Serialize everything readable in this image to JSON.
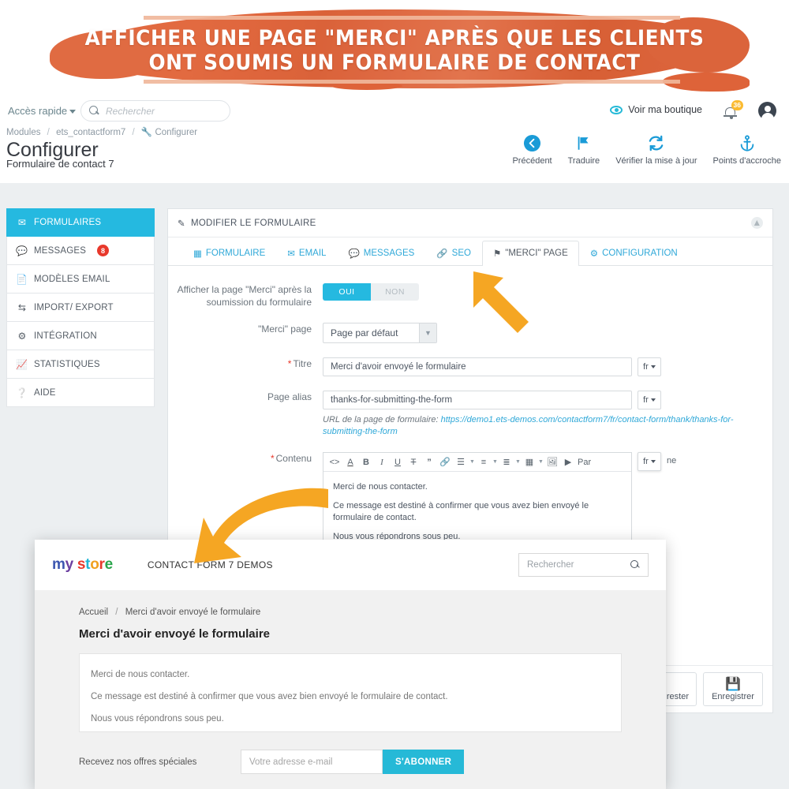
{
  "banner": {
    "line1": "AFFICHER UNE PAGE \"MERCI\" APRÈS QUE LES CLIENTS",
    "line2": "ONT SOUMIS UN FORMULAIRE DE CONTACT",
    "color": "#de6339"
  },
  "topbar": {
    "quick_access": "Accès rapide",
    "search_placeholder": "Rechercher",
    "view_shop": "Voir ma boutique",
    "notification_count": "36"
  },
  "breadcrumb": {
    "item1": "Modules",
    "item2": "ets_contactform7",
    "item3": "Configurer"
  },
  "page": {
    "title": "Configurer",
    "subtitle": "Formulaire de contact 7"
  },
  "header_actions": [
    {
      "label": "Précédent",
      "icon": "back-arrow-icon"
    },
    {
      "label": "Traduire",
      "icon": "flag-icon"
    },
    {
      "label": "Vérifier la mise à jour",
      "icon": "refresh-icon"
    },
    {
      "label": "Points d'accroche",
      "icon": "anchor-icon"
    }
  ],
  "sidebar": {
    "items": [
      {
        "label": "FORMULAIRES",
        "icon": "envelope-icon",
        "active": true,
        "badge": null
      },
      {
        "label": "MESSAGES",
        "icon": "chat-icon",
        "active": false,
        "badge": "8"
      },
      {
        "label": "MODÈLES EMAIL",
        "icon": "document-icon",
        "active": false,
        "badge": null
      },
      {
        "label": "IMPORT/ EXPORT",
        "icon": "exchange-icon",
        "active": false,
        "badge": null
      },
      {
        "label": "INTÉGRATION",
        "icon": "gears-icon",
        "active": false,
        "badge": null
      },
      {
        "label": "STATISTIQUES",
        "icon": "chart-icon",
        "active": false,
        "badge": null
      },
      {
        "label": "AIDE",
        "icon": "help-icon",
        "active": false,
        "badge": null
      }
    ]
  },
  "panel": {
    "header": "MODIFIER LE FORMULAIRE",
    "tabs": [
      {
        "label": "FORMULAIRE",
        "icon": "form-icon",
        "active": false
      },
      {
        "label": "EMAIL",
        "icon": "envelope-icon",
        "active": false
      },
      {
        "label": "MESSAGES",
        "icon": "chat-icon",
        "active": false
      },
      {
        "label": "SEO",
        "icon": "link-icon",
        "active": false
      },
      {
        "label": "\"MERCI\" PAGE",
        "icon": "flag-icon",
        "active": true
      },
      {
        "label": "CONFIGURATION",
        "icon": "gear-icon",
        "active": false
      }
    ],
    "form": {
      "show_thanks_label": "Afficher la page \"Merci\" après la soumission du formulaire",
      "toggle_on": "OUI",
      "toggle_off": "NON",
      "toggle_value": "OUI",
      "thanks_page_label": "\"Merci\" page",
      "thanks_page_value": "Page par défaut",
      "title_label": "Titre",
      "title_value": "Merci d'avoir envoyé le formulaire",
      "alias_label": "Page alias",
      "alias_value": "thanks-for-submitting-the-form",
      "lang": "fr",
      "url_note_prefix": "URL de la page de formulaire:",
      "url_note_link": "https://demo1.ets-demos.com/contactform7/fr/contact-form/thank/thanks-for-submitting-the-form",
      "content_label": "Contenu",
      "content_p1": "Merci de nous contacter.",
      "content_p2": "Ce message est destiné à confirmer que vous avez bien envoyé le formulaire de contact.",
      "content_p3": "Nous vous répondrons sous peu.",
      "toolbar_paragraph": "Par",
      "toolbar_size": "ne"
    },
    "footer": {
      "save_stay": "Enregistrer et rester",
      "save": "Enregistrer"
    }
  },
  "storefront": {
    "logo_letters": [
      "m",
      "y",
      "s",
      "t",
      "o",
      "r",
      "e"
    ],
    "logo_text": "my store",
    "nav": "CONTACT FORM 7 DEMOS",
    "search_placeholder": "Rechercher",
    "breadcrumb_home": "Accueil",
    "breadcrumb_current": "Merci d'avoir envoyé le formulaire",
    "heading": "Merci d'avoir envoyé le formulaire",
    "body_p1": "Merci de nous contacter.",
    "body_p2": "Ce message est destiné à confirmer que vous avez bien envoyé le formulaire de contact.",
    "body_p3": "Nous vous répondrons sous peu.",
    "newsletter_label": "Recevez nos offres spéciales",
    "newsletter_placeholder": "Votre adresse e-mail",
    "newsletter_button": "S'ABONNER"
  },
  "colors": {
    "accent": "#25b9e0",
    "banner": "#de6339",
    "arrow": "#f5a623",
    "danger": "#e8382b"
  }
}
